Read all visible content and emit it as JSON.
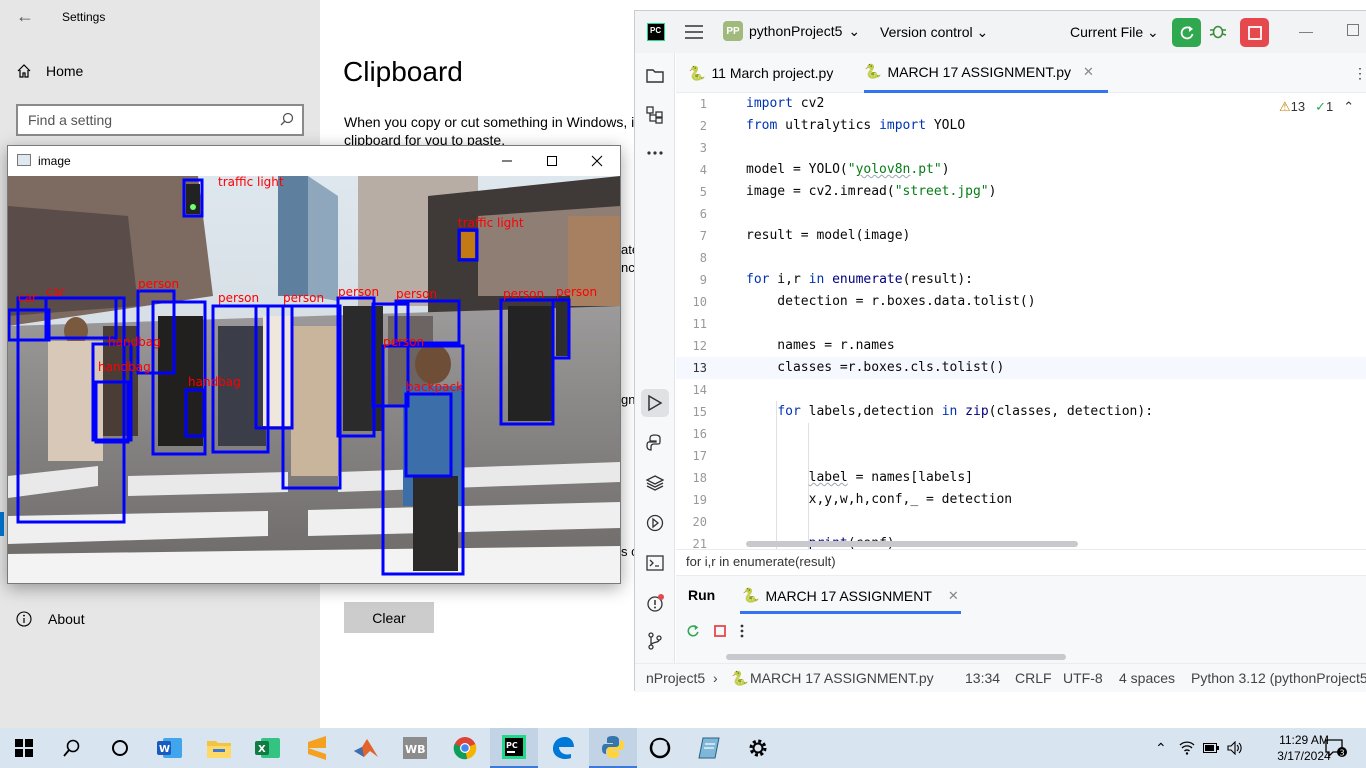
{
  "settings": {
    "window_title": "Settings",
    "home_label": "Home",
    "search_placeholder": "Find a setting",
    "page_title": "Clipboard",
    "description_line1": "When you copy or cut something in Windows, i",
    "description_line2": "clipboard for you to paste.",
    "fragments": [
      "ate",
      "nc",
      "gn",
      "s c"
    ],
    "clear_label": "Clear",
    "about_label": "About"
  },
  "image_window": {
    "title": "image",
    "labels": [
      "traffic light",
      "car",
      "car",
      "person",
      "person",
      "person",
      "person",
      "person",
      "person",
      "handbag",
      "handbag",
      "handbag",
      "backpack",
      "person",
      "person"
    ]
  },
  "ide": {
    "project_badge": "PP",
    "project_name": "pythonProject5",
    "vcs_label": "Version control",
    "run_config": "Current File",
    "tabs": [
      {
        "label": "11 March project.py"
      },
      {
        "label": "MARCH 17 ASSIGNMENT.py"
      }
    ],
    "warnings": "13",
    "checks": "1",
    "line_numbers": [
      "1",
      "2",
      "3",
      "4",
      "5",
      "6",
      "7",
      "8",
      "9",
      "10",
      "11",
      "12",
      "13",
      "14",
      "15",
      "16",
      "17",
      "18",
      "19",
      "20",
      "21"
    ],
    "breadcrumb": "for i,r in enumerate(result)",
    "run_label": "Run",
    "run_tab": "MARCH 17 ASSIGNMENT",
    "status": {
      "project": "nProject5",
      "file": "MARCH 17 ASSIGNMENT.py",
      "position": "13:34",
      "line_sep": "CRLF",
      "encoding": "UTF-8",
      "indent": "4 spaces",
      "interpreter": "Python 3.12 (pythonProject5"
    }
  },
  "taskbar": {
    "time": "11:29 AM",
    "date": "3/17/2024",
    "notification_count": "3",
    "apps": [
      "start-icon",
      "search-icon",
      "cortana-icon",
      "word-icon",
      "file-explorer-icon",
      "excel-icon",
      "sublime-icon",
      "matlab-icon",
      "wb-icon",
      "chrome-icon",
      "pycharm-icon",
      "edge-icon",
      "python-icon",
      "obs-icon",
      "notes-icon",
      "settings-icon"
    ]
  },
  "colors": {
    "accent": "#3574f0",
    "detect_box": "#0000ff",
    "detect_label": "#ff0000",
    "run_green": "#2fa84f",
    "stop_red": "#e5484d"
  }
}
